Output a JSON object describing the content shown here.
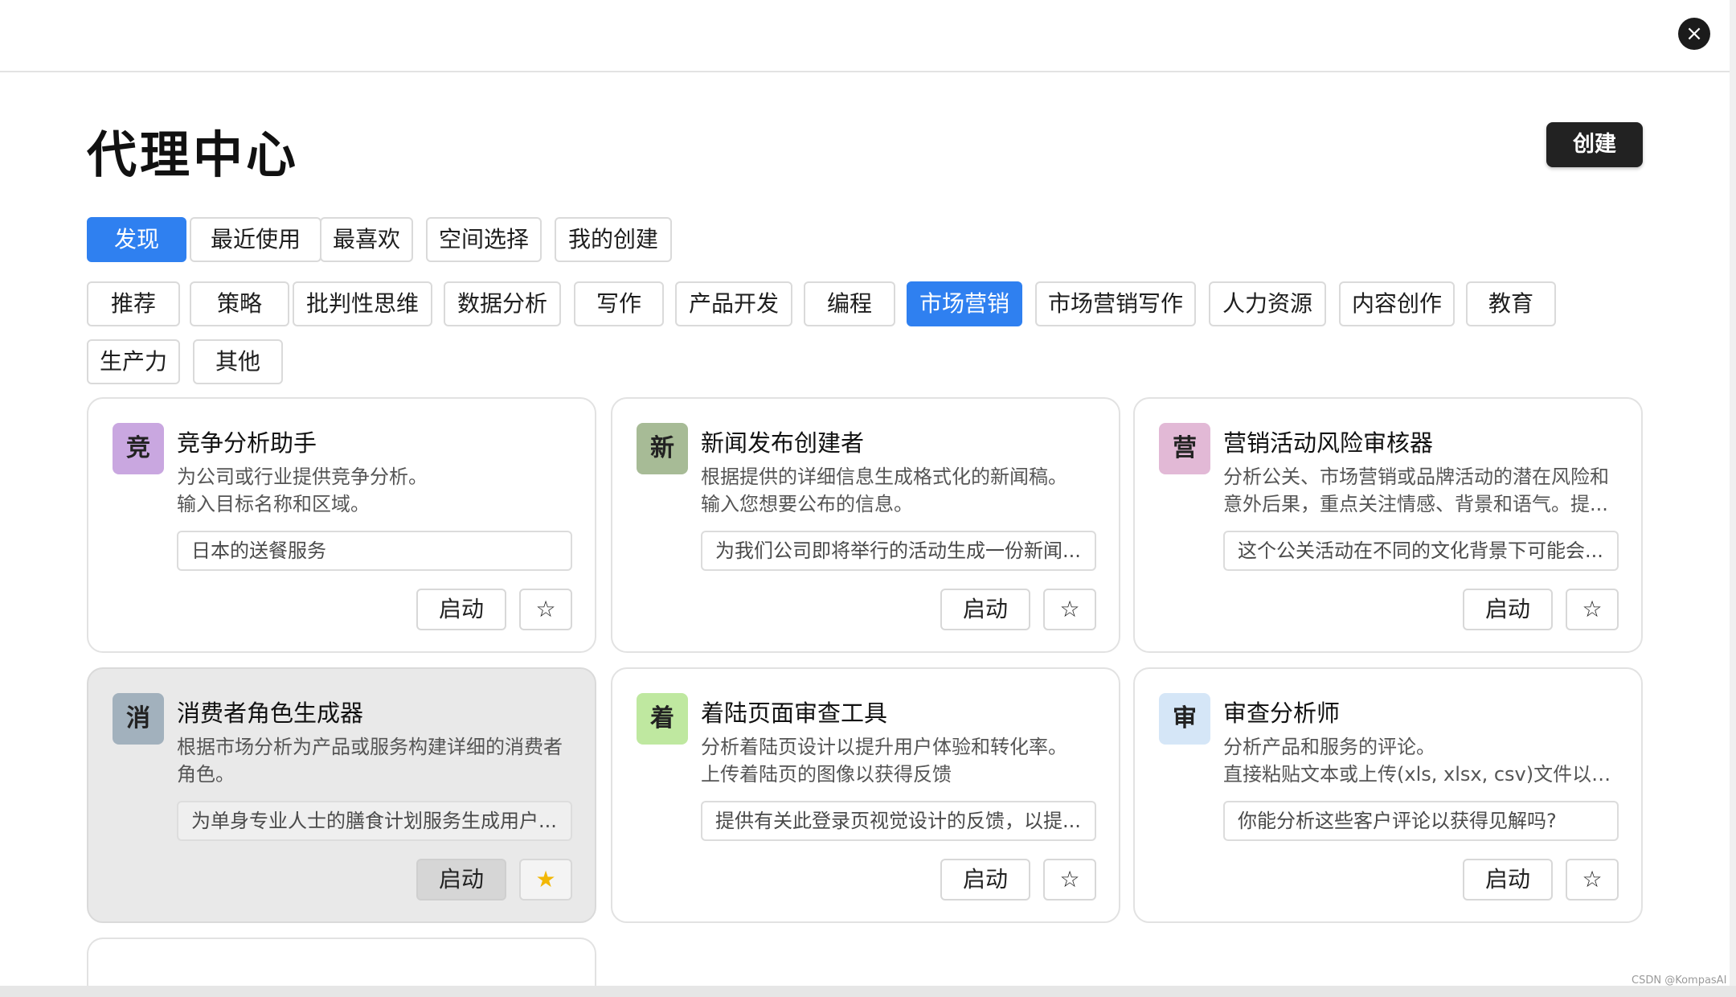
{
  "title": "代理中心",
  "create_label": "创建",
  "close_icon": "×",
  "filter_tabs": [
    {
      "label": "发现",
      "active": true
    },
    {
      "label": "最近使用"
    },
    {
      "label": "最喜欢"
    },
    {
      "label": "空间选择"
    },
    {
      "label": "我的创建"
    }
  ],
  "categories": [
    {
      "label": "推荐"
    },
    {
      "label": "策略"
    },
    {
      "label": "批判性思维"
    },
    {
      "label": "数据分析"
    },
    {
      "label": "写作"
    },
    {
      "label": "产品开发"
    },
    {
      "label": "编程"
    },
    {
      "label": "市场营销",
      "active": true
    },
    {
      "label": "市场营销写作"
    },
    {
      "label": "人力资源"
    },
    {
      "label": "内容创作"
    },
    {
      "label": "教育"
    },
    {
      "label": "生产力"
    },
    {
      "label": "其他"
    }
  ],
  "agents": [
    {
      "avatar": "竞",
      "avatar_color": "#c9a7e0",
      "title": "竞争分析助手",
      "desc": [
        "为公司或行业提供竞争分析。",
        "输入目标名称和区域。"
      ],
      "input": "日本的送餐服务",
      "launch_label": "启动",
      "favorite": false
    },
    {
      "avatar": "新",
      "avatar_color": "#a7bb96",
      "title": "新闻发布创建者",
      "desc": [
        "根据提供的详细信息生成格式化的新闻稿。",
        "输入您想要公布的信息。"
      ],
      "input": "为我们公司即将举行的活动生成一份新闻...",
      "launch_label": "启动",
      "favorite": false
    },
    {
      "avatar": "营",
      "avatar_color": "#e2b9d6",
      "title": "营销活动风险审核器",
      "desc": [
        "分析公关、市场营销或品牌活动的潜在风险和",
        "意外后果，重点关注情感、背景和语气。提..."
      ],
      "input": "这个公关活动在不同的文化背景下可能会...",
      "launch_label": "启动",
      "favorite": false
    },
    {
      "avatar": "消",
      "avatar_color": "#a2b1bd",
      "title": "消费者角色生成器",
      "desc": [
        "根据市场分析为产品或服务构建详细的消费者",
        "角色。"
      ],
      "input": "为单身专业人士的膳食计划服务生成用户...",
      "launch_label": "启动",
      "favorite": true,
      "hover": true
    },
    {
      "avatar": "着",
      "avatar_color": "#bfe8a0",
      "title": "着陆页面审查工具",
      "desc": [
        "分析着陆页设计以提升用户体验和转化率。",
        "上传着陆页的图像以获得反馈"
      ],
      "input": "提供有关此登录页视觉设计的反馈，以提...",
      "launch_label": "启动",
      "favorite": false
    },
    {
      "avatar": "审",
      "avatar_color": "#d5e6f7",
      "title": "审查分析师",
      "desc": [
        "分析产品和服务的评论。",
        "直接粘贴文本或上传(xls, xlsx, csv)文件以获..."
      ],
      "input": "你能分析这些客户评论以获得见解吗?",
      "launch_label": "启动",
      "favorite": false
    }
  ],
  "watermark": "CSDN @KompasAI"
}
